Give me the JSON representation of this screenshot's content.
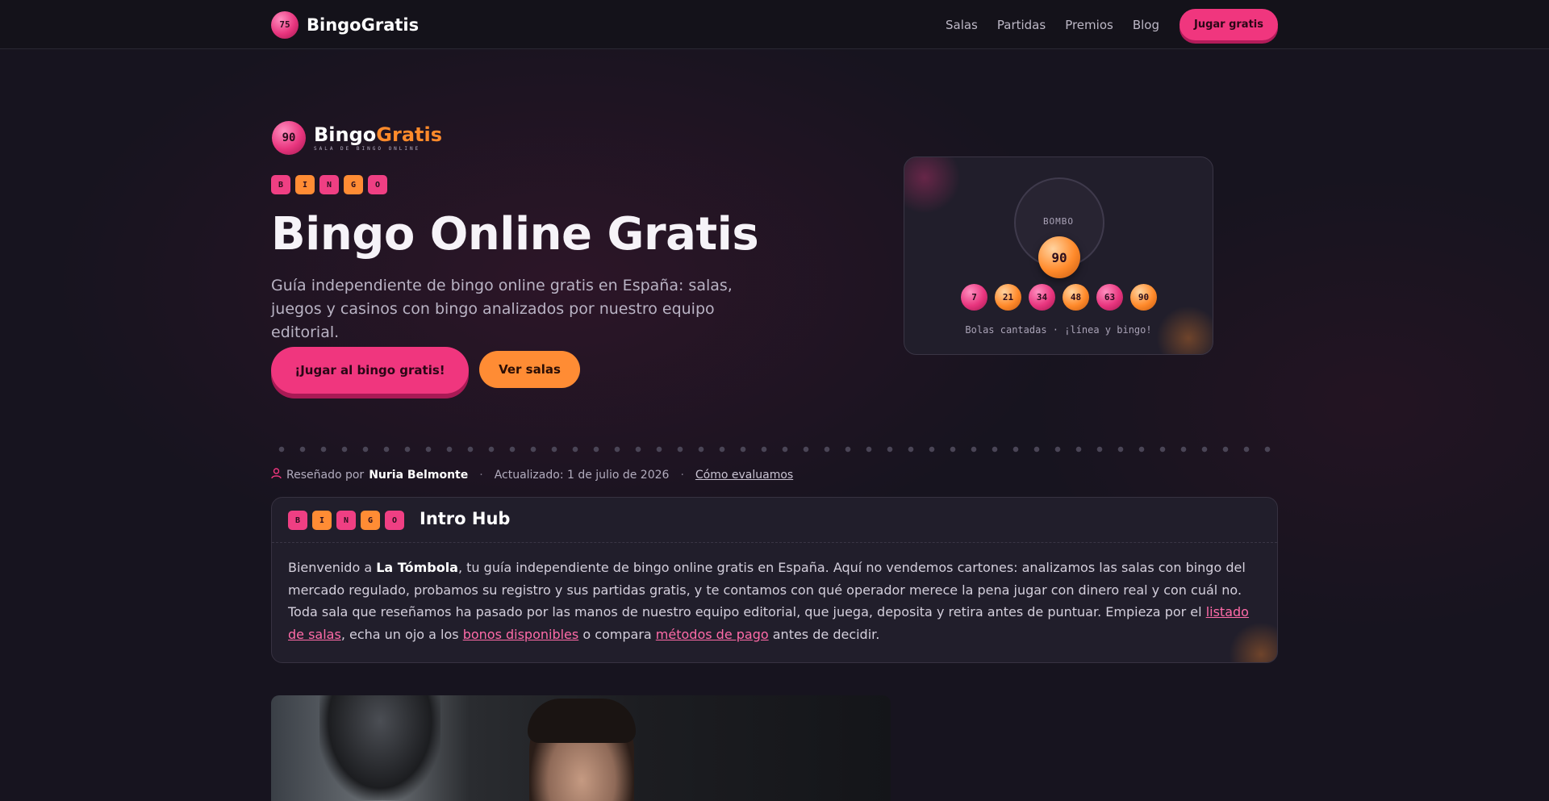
{
  "nav": {
    "ball_number": "75",
    "brand": "BingoGratis",
    "links": [
      "Salas",
      "Partidas",
      "Premios",
      "Blog"
    ],
    "cta": "Jugar gratis"
  },
  "hero": {
    "logo_ball": "90",
    "logo_name_main": "Bingo",
    "logo_name_accent": "Gratis",
    "logo_sub": "SALA DE BINGO ONLINE",
    "bingo_letters": [
      "B",
      "I",
      "N",
      "G",
      "O"
    ],
    "title": "Bingo Online Gratis",
    "subtitle": "Guía independiente de bingo online gratis en España: salas, juegos y casinos con bingo analizados por nuestro equipo editorial.",
    "primary_button": "¡Jugar al bingo gratis!",
    "secondary_button": "Ver salas"
  },
  "bombo": {
    "label": "BOMBO",
    "current_ball": "90",
    "called_balls": [
      "7",
      "21",
      "34",
      "48",
      "63",
      "90"
    ],
    "caption": "Bolas cantadas · ¡línea y bingo!"
  },
  "meta": {
    "reviewed_by": "Reseñado por",
    "author": "Nuria Belmonte",
    "updated": "Actualizado: 1 de julio de 2026",
    "how_link": "Cómo evaluamos",
    "separator": "·"
  },
  "intro": {
    "letters": [
      "B",
      "I",
      "N",
      "G",
      "O"
    ],
    "title": "Intro Hub",
    "p1": "Bienvenido a ",
    "brand": "La Tómbola",
    "p2": ", tu guía independiente de bingo online gratis en España. Aquí no vendemos cartones: analizamos las salas con bingo del mercado regulado, probamos su registro y sus partidas gratis, y te contamos con qué operador merece la pena jugar con dinero real y con cuál no. Toda sala que reseñamos ha pasado por las manos de nuestro equipo editorial, que juega, deposita y retira antes de puntuar. Empieza por el ",
    "link1": "listado de salas",
    "p3": ", echa un ojo a los ",
    "link2": "bonos disponibles",
    "p4": " o compara ",
    "link3": "métodos de pago",
    "p5": " antes de decidir."
  },
  "colors": {
    "pink": "#f0367e",
    "orange": "#ff8c34",
    "background": "#17141f"
  }
}
